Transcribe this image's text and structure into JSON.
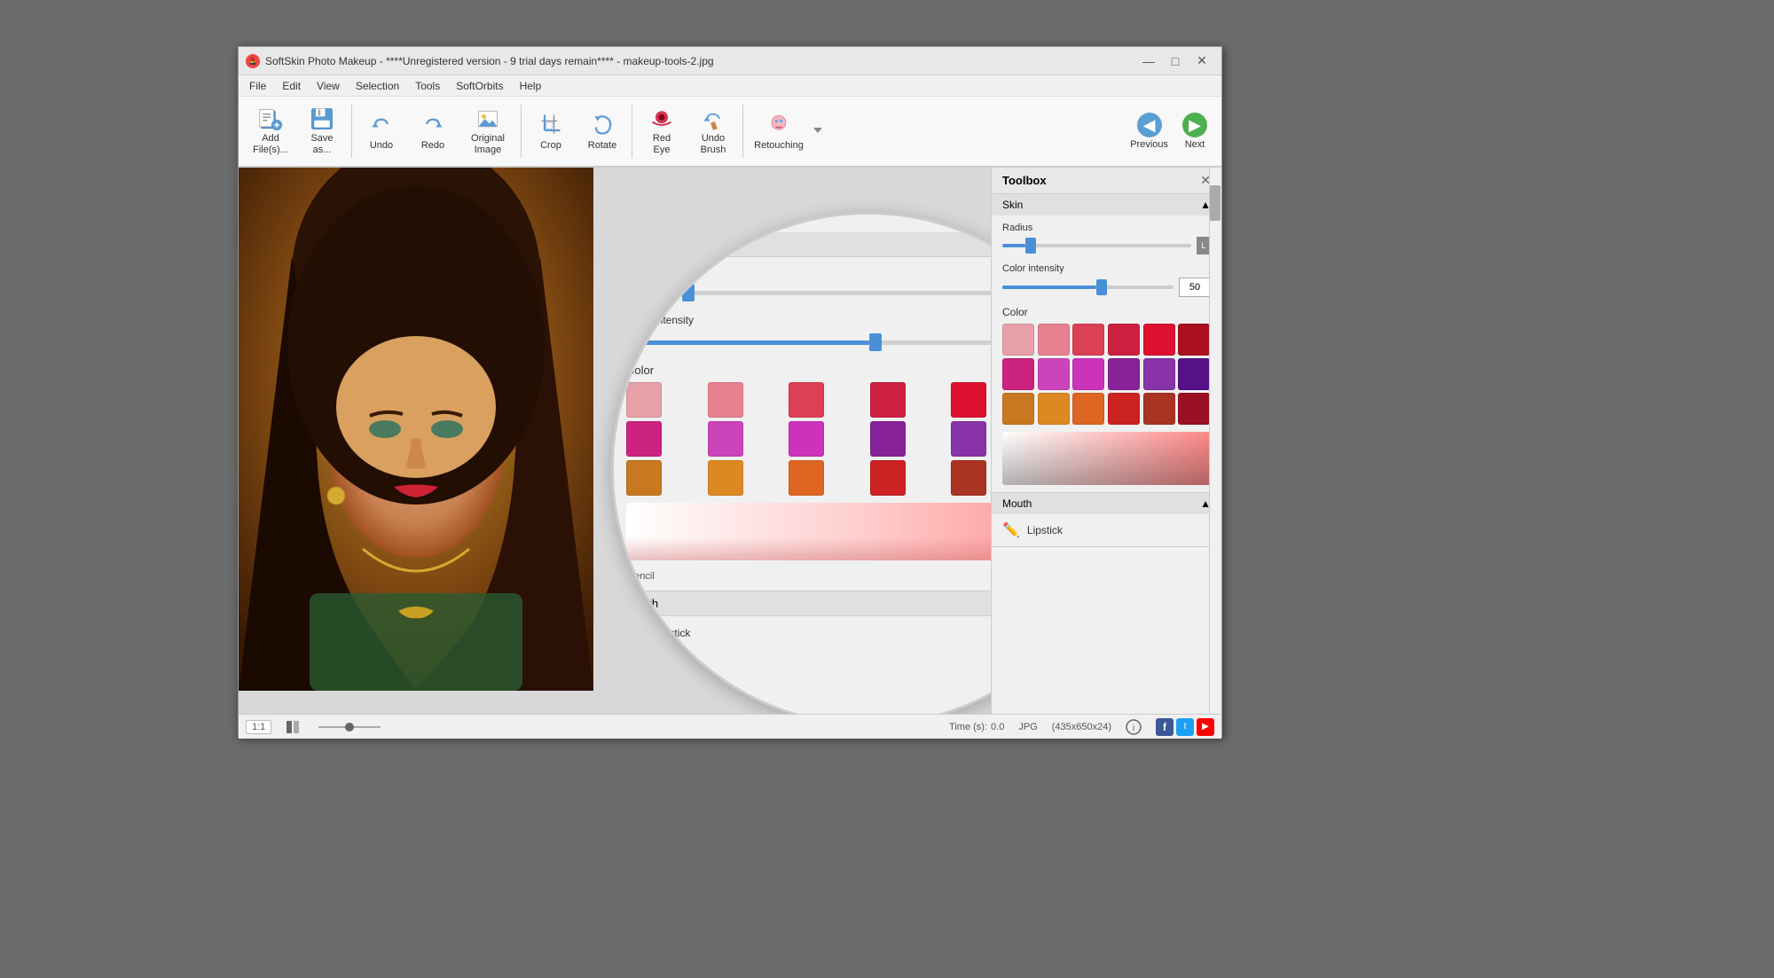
{
  "window": {
    "title": "SoftSkin Photo Makeup - ****Unregistered version - 9 trial days remain**** - makeup-tools-2.jpg",
    "icon": "💄"
  },
  "titlebar": {
    "minimize": "—",
    "maximize": "□",
    "close": "✕"
  },
  "menu": {
    "items": [
      "File",
      "Edit",
      "View",
      "Selection",
      "Tools",
      "SoftOrbits",
      "Help"
    ]
  },
  "toolbar": {
    "buttons": [
      {
        "id": "add-files",
        "label": "Add\nFile(s)...",
        "icon": "add-files-icon"
      },
      {
        "id": "save-as",
        "label": "Save\nas...",
        "icon": "save-icon"
      },
      {
        "id": "undo",
        "label": "Undo",
        "icon": "undo-icon"
      },
      {
        "id": "redo",
        "label": "Redo",
        "icon": "redo-icon"
      },
      {
        "id": "original-image",
        "label": "Original\nImage",
        "icon": "original-icon"
      },
      {
        "id": "crop",
        "label": "Crop",
        "icon": "crop-icon"
      },
      {
        "id": "rotate",
        "label": "Rotate",
        "icon": "rotate-icon"
      },
      {
        "id": "red-eye",
        "label": "Red\nEye",
        "icon": "redeye-icon"
      },
      {
        "id": "undo-brush",
        "label": "Undo\nBrush",
        "icon": "undobrush-icon"
      },
      {
        "id": "retouching",
        "label": "Retouching",
        "icon": "retouching-icon"
      }
    ],
    "nav": {
      "previous": "Previous",
      "next": "Next"
    }
  },
  "toolbox": {
    "title": "Toolbox",
    "sections": {
      "skin": {
        "label": "Skin",
        "radius": {
          "label": "Radius",
          "value": 15,
          "percent": 12
        },
        "color_intensity": {
          "label": "Color intensity",
          "value": 50,
          "percent": 55
        },
        "color": {
          "label": "Color",
          "swatches": [
            "#e8a0a8",
            "#e8919c",
            "#dc5060",
            "#cc2244",
            "#dd1144",
            "#aa1122",
            "#cc2288",
            "#cc44bb",
            "#cc33bb",
            "#882299",
            "#8833aa",
            "#441188",
            "#c87820",
            "#dd8822",
            "#dd6622",
            "#cc2222",
            "#aa3322",
            "#991122"
          ]
        }
      },
      "mouth": {
        "label": "Mouth",
        "lipstick": "Lipstick"
      }
    }
  },
  "statusbar": {
    "zoom": "1:1",
    "time_label": "Time (s):",
    "time_value": "0.0",
    "format": "JPG",
    "dimensions": "(435x650x24)"
  }
}
